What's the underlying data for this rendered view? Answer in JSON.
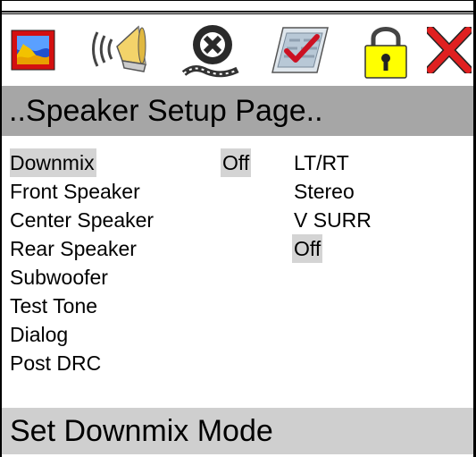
{
  "toolbar": {
    "icons": [
      {
        "name": "picture-settings-icon"
      },
      {
        "name": "speaker-audio-icon"
      },
      {
        "name": "film-reel-icon"
      },
      {
        "name": "checklist-icon"
      },
      {
        "name": "lock-icon"
      },
      {
        "name": "close-icon"
      }
    ],
    "colors": {
      "padlock": "#ffff00",
      "close": "#e02020",
      "picture_frame": "#d41010"
    }
  },
  "page": {
    "title": "..Speaker Setup Page..",
    "status": "Set Downmix Mode"
  },
  "menu": {
    "items": [
      {
        "label": "Downmix",
        "selected": true
      },
      {
        "label": "Front Speaker"
      },
      {
        "label": "Center Speaker"
      },
      {
        "label": "Rear Speaker"
      },
      {
        "label": "Subwoofer"
      },
      {
        "label": "Test Tone"
      },
      {
        "label": "Dialog"
      },
      {
        "label": "Post DRC"
      }
    ]
  },
  "current_value": {
    "label": "Off"
  },
  "options": {
    "items": [
      {
        "label": "LT/RT"
      },
      {
        "label": "Stereo"
      },
      {
        "label": "V SURR"
      },
      {
        "label": "Off",
        "selected": true
      }
    ]
  },
  "colors": {
    "title_bg": "#a6a6a6",
    "status_bg": "#cfcfcf",
    "highlight": "#d4d4d4"
  }
}
